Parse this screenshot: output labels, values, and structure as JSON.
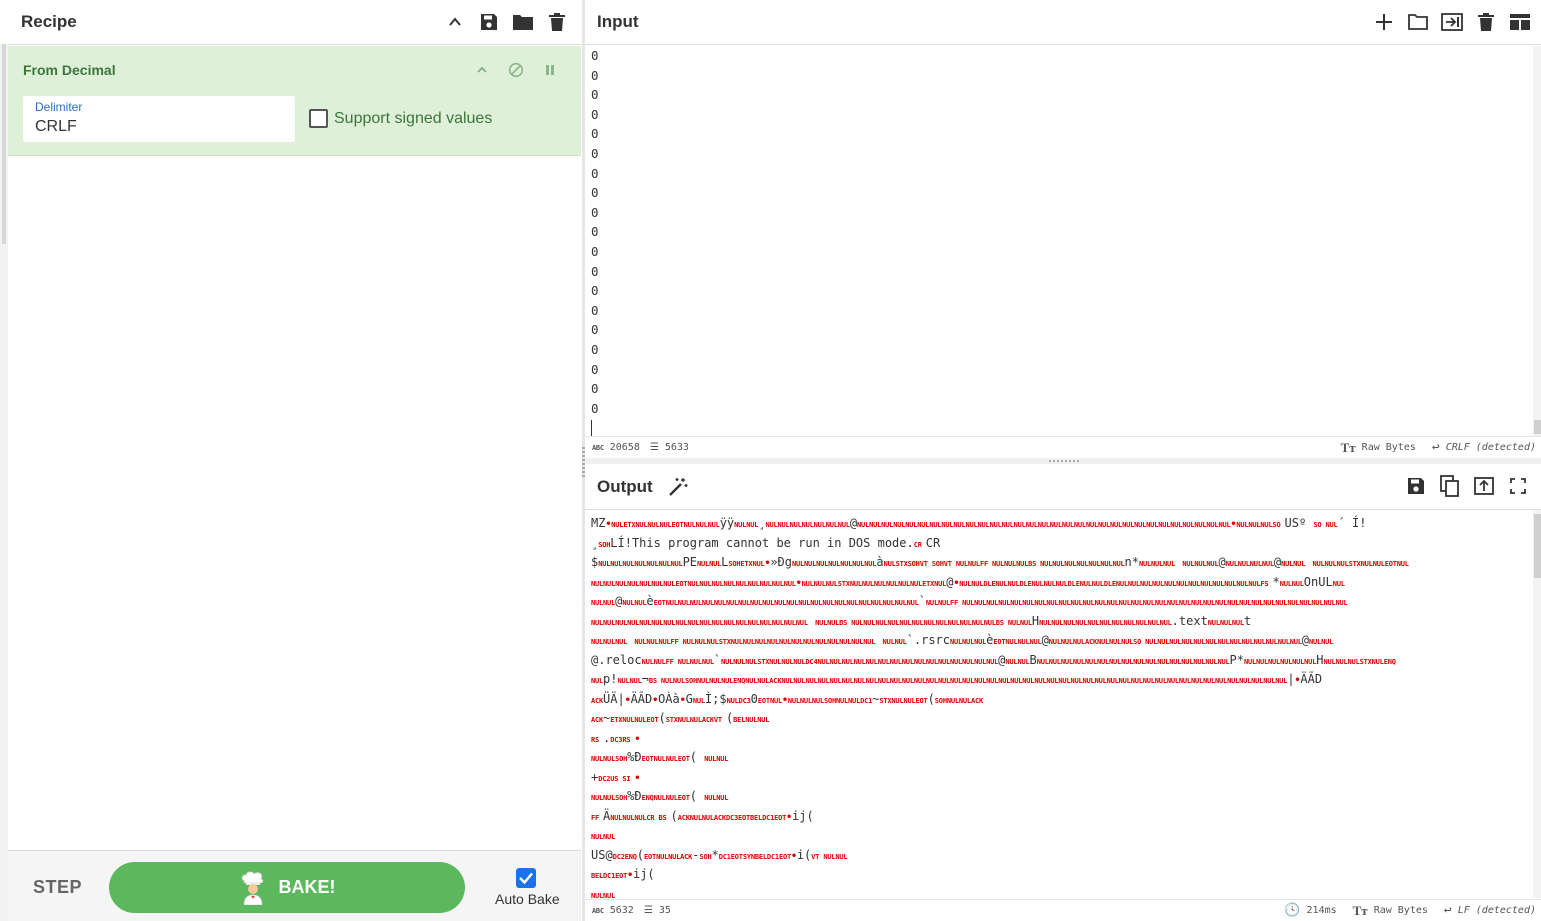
{
  "recipe": {
    "title": "Recipe",
    "operation": {
      "name": "From Decimal",
      "delimiter_label": "Delimiter",
      "delimiter_value": "CRLF",
      "signed_label": "Support signed values",
      "signed_checked": false
    },
    "step_label": "STEP",
    "bake_label": "BAKE!",
    "auto_bake_label": "Auto Bake",
    "auto_bake_checked": true
  },
  "input": {
    "title": "Input",
    "lines": [
      "0",
      "0",
      "0",
      "0",
      "0",
      "0",
      "0",
      "0",
      "0",
      "0",
      "0",
      "0",
      "0",
      "0",
      "0",
      "0",
      "0",
      "0",
      "0"
    ],
    "status": {
      "chars": "20658",
      "lines": "5633",
      "encoding": "Raw Bytes",
      "eol": "CRLF (detected)"
    }
  },
  "output": {
    "title": "Output",
    "lines": [
      "MZ•NULETXNULNULNULEOTNULNULNULÿÿNULNUL¸NULNULNULNULNULNULNUL@NULNULNULNULNULNULNULNULNULNULNULNULNULNULNULNULNULNULNULNULNULNULNULNULNULNULNULNULNULNULNUL•NULNULNULSO USº SO NUL´ Í!",
      "¸SOHLÍ!This program cannot be run in DOS mode.CR CR",
      "$NULNULNULNULNULNULNULPENULNULLSOHETXNUL•»ÐgNULNULNULNULNULNULNULàNULSTXSOHVT SOHVT NULNULFF NULNULNULBS NULNULNULNULNULNULNULn*NULNULNUL NULNULNUL@NULNULNULNUL@NULNUL NULNULNULSTXNULNULEOTNUL",
      "NULNULNULNULNULNULNULEOTNULNULNULNULNULNULNULNULNUL•NULNULNULSTXNULNULNULNULNULNULETXNUL@•NULNULDLENULNULDLENULNULNULDLENULNULDLENULNULNULNULNULNULNULNULNULNULNULNULFS *NULNULOnULNUL",
      "NULNUL@NULNULèEOTNULNULNULNULNULNULNULNULNULNULNULNULNULNULNULNULNULNULNULNULNUL`NULNULFF NULNULNULNULNULNULNULNULNULNULNULNULNULNULNULNULNULNULNULNULNULNULNULNULNULNULNULNULNULNULNULNUL",
      "NULNULNULNULNULNULNULNULNULNULNULNULNULNULNULNULNULNUL NULNULBS NULNULNULNULNULNULNULNULNULNULNULNULBS NULNULHNULNULNULNULNULNULNULNULNULNULNUL.textNULNULNULt",
      "NULNULNUL NULNULNULFF NULNULNULSTXNULNULNULNULNULNULNULNULNULNULNULNUL NULNUL`.rsrcNULNULNULèEOTNULNULNUL@NULNULNULACKNULNULNULSO NULNULNULNULNULNULNULNULNULNULNULNULNUL@NULNUL",
      "@.relocNULNULFF NULNULNUL`NULNULNULSTXNULNULNULDC4NULNULNULNULNULNULNULNULNULNULNULNULNULNULNUL@NULNULBNULNULNULNULNULNULNULNULNULNULNULNULNULNULNULNULP*NULNULNULNULNULNULHNULNULNULSTXNULENQ",
      "NULp!NULNUL¬BS NULNULSOHNULNULNULENQNULNULACKNULNULNULNULNULNULNULNULNULNULNULNULNULNULNULNULNULNULNULNULNULNULNULNULNULNULNULNULNULNULNULNULNULNULNULNULNULNULNULNULNULNUL|•ÄÃD",
      "ACKÜÄ|•ÄÃD•OÀà•GNULÌ;$NULDC30EOTNUL•NULNULNULSOHNULNULDC1~STXNULNULEOT(SOHNULNULACK",
      "ACK~ETXNULNULEOT(STXNULNULACKVT (BELNULNUL",
      "RS .DC3RS •",
      "NULNULSOH%ÐEOTNULNULEOT(      NULNUL",
      "+DC2US SI •",
      "NULNULSOH%ÐENQNULNULEOT(      NULNUL",
      "FF ÄNULNULNULCR BS     (ACKNULNULACKDC3EOTBELDC1EOT•ij(",
      "NULNUL",
      "US@DC2ENQ(EOTNULNULACK-SOH*DC1EOTSYNBELDC1EOT•i(VT NULNUL",
      "BELDC1EOT•ij(",
      "NULNUL"
    ],
    "status": {
      "chars": "5632",
      "lines": "35",
      "time": "214ms",
      "encoding": "Raw Bytes",
      "eol": "LF (detected)"
    }
  },
  "icons": {
    "recipe_head": [
      "chevron-up-icon",
      "save-icon",
      "folder-icon",
      "trash-icon"
    ],
    "input_head": [
      "plus-icon",
      "folder-icon",
      "import-icon",
      "trash-icon",
      "layout-icon"
    ],
    "output_head": [
      "save-icon",
      "copy-icon",
      "replace-input-icon",
      "fullscreen-icon"
    ],
    "magic": "magic-wand-icon"
  },
  "colors": {
    "op_bg": "#dff0d8",
    "op_text": "#3c763d",
    "bake_green": "#5cb85c",
    "control_char_red": "#e00000",
    "accent_blue": "#1a73e8"
  }
}
